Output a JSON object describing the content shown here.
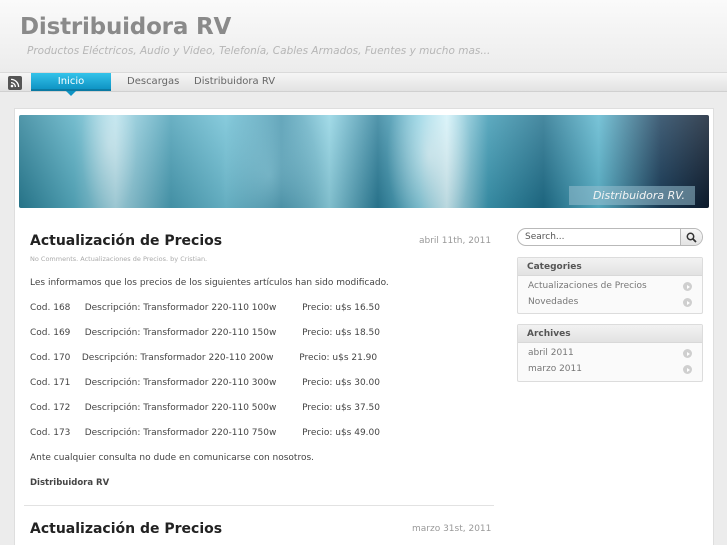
{
  "header": {
    "title": "Distribuidora RV",
    "tagline": "Productos Eléctricos, Audio y Video, Telefonía, Cables Armados, Fuentes y mucho mas..."
  },
  "nav": {
    "rss_icon": "rss-icon",
    "items": [
      "Inicio",
      "Descargas",
      "Distribuidora RV"
    ],
    "active": "Inicio"
  },
  "banner": {
    "caption": "Distribuidora RV."
  },
  "posts": [
    {
      "title": "Actualización de Precios",
      "date": "abril 11th, 2011",
      "meta": "No Comments. Actualizaciones de Precios. by Cristian.",
      "intro": "Les informamos que los precios de los siguientes artículos han sido modificado.",
      "lines": [
        "Cod. 168     Descripción: Transformador 220-110 100w         Precio: u$s 16.50",
        "Cod. 169     Descripción: Transformador 220-110 150w         Precio: u$s 18.50",
        "Cod. 170    Descripción: Transformador 220-110 200w         Precio: u$s 21.90",
        "Cod. 171     Descripción: Transformador 220-110 300w         Precio: u$s 30.00",
        "Cod. 172     Descripción: Transformador 220-110 500w         Precio: u$s 37.50",
        "Cod. 173     Descripción: Transformador 220-110 750w         Precio: u$s 49.00"
      ],
      "outro": "Ante cualquier consulta no dude en comunicarse con nosotros.",
      "signature": "Distribuidora RV"
    },
    {
      "title": "Actualización de Precios",
      "date": "marzo 31st, 2011"
    }
  ],
  "sidebar": {
    "search": {
      "placeholder": "Search...",
      "button_icon": "search-icon"
    },
    "categories": {
      "title": "Categories",
      "items": [
        "Actualizaciones de Precios",
        "Novedades"
      ]
    },
    "archives": {
      "title": "Archives",
      "items": [
        "abril 2011",
        "marzo 2011"
      ]
    }
  },
  "colors": {
    "accent": "#0f94c4",
    "title_gray": "#8a8a8a",
    "background": "#ececec"
  }
}
